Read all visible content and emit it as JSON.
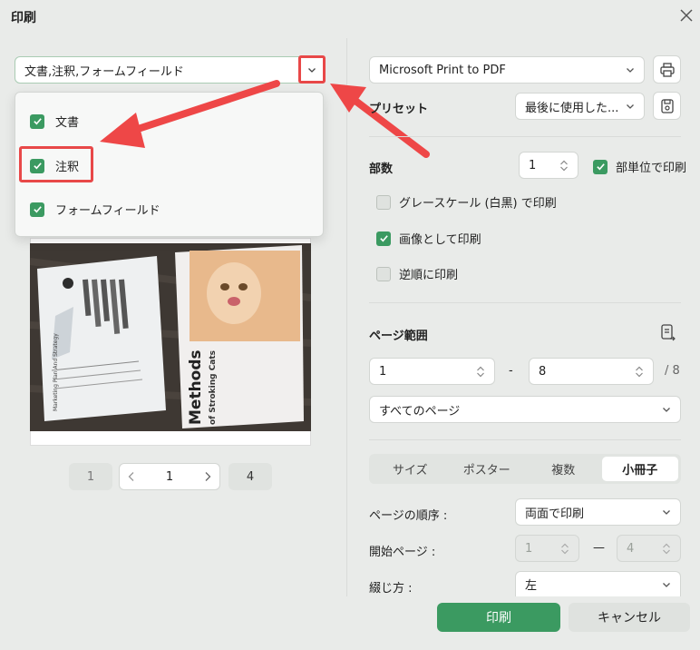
{
  "window": {
    "title": "印刷"
  },
  "content_select": {
    "value": "文書,注釈,フォームフィールド"
  },
  "dropdown": {
    "items": [
      {
        "label": "文書",
        "checked": true
      },
      {
        "label": "注釈",
        "checked": true
      },
      {
        "label": "フォームフィールド",
        "checked": true
      }
    ]
  },
  "preview": {
    "left_page": {
      "title": "Marketing Plan And Strategy"
    },
    "right_page": {
      "title": "Methods",
      "subtitle": "of Stroking Cats"
    }
  },
  "pager": {
    "first": "1",
    "current": "1",
    "last": "4"
  },
  "printer": {
    "value": "Microsoft Print to PDF"
  },
  "preset": {
    "label": "プリセット",
    "value": "最後に使用した..."
  },
  "copies": {
    "label": "部数",
    "value": "1",
    "collate_label": "部単位で印刷",
    "collate": true
  },
  "options": [
    {
      "label": "グレースケール (白黒) で印刷",
      "checked": false
    },
    {
      "label": "画像として印刷",
      "checked": true
    },
    {
      "label": "逆順に印刷",
      "checked": false
    }
  ],
  "page_range": {
    "label": "ページ範囲",
    "from": "1",
    "separator": "-",
    "to": "8",
    "total": "/ 8",
    "subset": "すべてのページ"
  },
  "layout_tabs": {
    "items": [
      "サイズ",
      "ポスター",
      "複数",
      "小冊子"
    ],
    "active": "小冊子"
  },
  "booklet": {
    "order_label": "ページの順序 :",
    "order_value": "両面で印刷",
    "start_label": "開始ページ :",
    "start_from": "1",
    "start_sep": "—",
    "start_to": "4",
    "binding_label": "綴じ方 :",
    "binding_value": "左"
  },
  "actions": {
    "print": "印刷",
    "cancel": "キャンセル"
  },
  "colors": {
    "accent": "#3b9a61",
    "highlight": "#e84848"
  }
}
